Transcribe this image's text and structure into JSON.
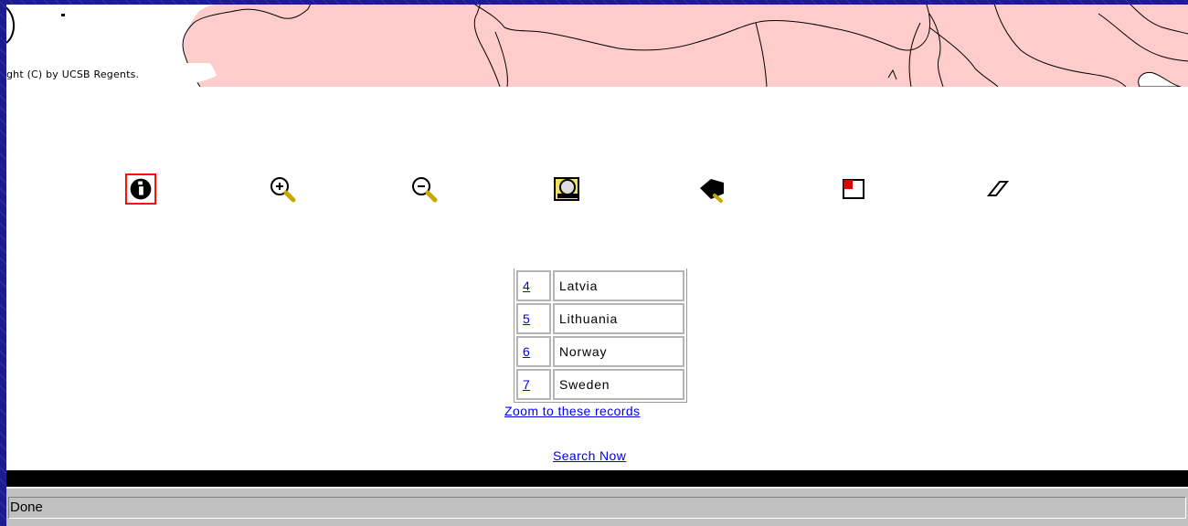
{
  "map": {
    "copyright": "ght (C) by UCSB Regents.",
    "land_color": "#ffcccc",
    "border_color": "#000000"
  },
  "toolbar": {
    "tools": [
      {
        "name": "info-icon",
        "label": "Identify"
      },
      {
        "name": "zoom-in-icon",
        "label": "Zoom in"
      },
      {
        "name": "zoom-out-icon",
        "label": "Zoom out"
      },
      {
        "name": "zoom-full-icon",
        "label": "Full extent"
      },
      {
        "name": "pan-icon",
        "label": "Pan"
      },
      {
        "name": "select-box-icon",
        "label": "Select"
      },
      {
        "name": "eraser-icon",
        "label": "Clear"
      }
    ],
    "selected_color": "#ff0000"
  },
  "results": {
    "rows": [
      {
        "num": "4",
        "name": "Latvia"
      },
      {
        "num": "5",
        "name": "Lithuania"
      },
      {
        "num": "6",
        "name": "Norway"
      },
      {
        "num": "7",
        "name": "Sweden"
      }
    ],
    "zoom_link": "Zoom to these records",
    "search_link": "Search Now"
  },
  "status": {
    "text": "Done"
  },
  "colors": {
    "link": "#0000ee",
    "frame": "#1c1c8e",
    "statusbar": "#c0c0c0"
  }
}
